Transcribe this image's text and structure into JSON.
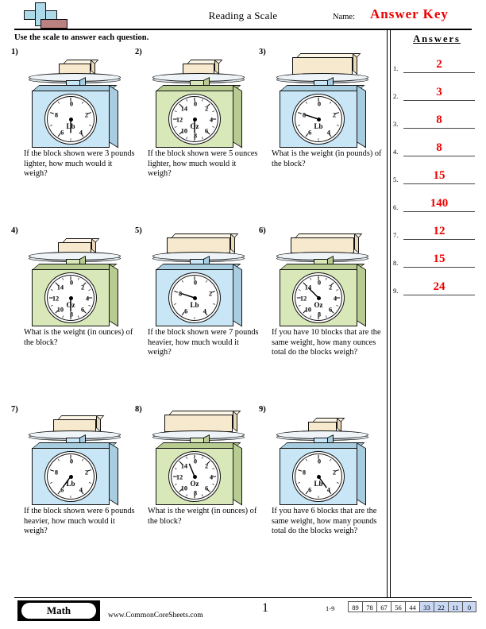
{
  "header": {
    "title": "Reading a Scale",
    "name_label": "Name:",
    "name_value": "Answer Key",
    "logo_icon": "plus-block-logo",
    "accent_color": "#ee0000"
  },
  "instructions": "Use the scale to answer each question.",
  "answers_panel": {
    "title": "Answers",
    "rows": [
      {
        "num": "1.",
        "value": "2"
      },
      {
        "num": "2.",
        "value": "3"
      },
      {
        "num": "3.",
        "value": "8"
      },
      {
        "num": "4.",
        "value": "8"
      },
      {
        "num": "5.",
        "value": "15"
      },
      {
        "num": "6.",
        "value": "140"
      },
      {
        "num": "7.",
        "value": "12"
      },
      {
        "num": "8.",
        "value": "15"
      },
      {
        "num": "9.",
        "value": "24"
      }
    ]
  },
  "problems": [
    {
      "num": "1)",
      "text": "If the block shown were 3 pounds lighter, how much would it weigh?",
      "scale": {
        "color": "#c8e6f5",
        "color_dark": "#a8cde0",
        "unit": "Lb",
        "ticks": [
          "0",
          "2",
          "4",
          "6",
          "8"
        ],
        "max": 10,
        "reading": 5,
        "block_width": 40,
        "block_height": 14
      }
    },
    {
      "num": "2)",
      "text": "If the block shown were 5 ounces lighter, how much would it weigh?",
      "scale": {
        "color": "#d8e8b8",
        "color_dark": "#b8cc92",
        "unit": "Oz",
        "ticks": [
          "0",
          "2",
          "4",
          "6",
          "8",
          "10",
          "12",
          "14"
        ],
        "max": 16,
        "reading": 8,
        "block_width": 40,
        "block_height": 14
      }
    },
    {
      "num": "3)",
      "text": "What is the weight (in pounds) of the block?",
      "scale": {
        "color": "#c8e6f5",
        "color_dark": "#a8cde0",
        "unit": "Lb",
        "ticks": [
          "0",
          "2",
          "4",
          "6",
          "8"
        ],
        "max": 10,
        "reading": 8,
        "block_width": 76,
        "block_height": 22
      }
    },
    {
      "num": "4)",
      "text": "What is the weight (in ounces) of the block?",
      "scale": {
        "color": "#d8e8b8",
        "color_dark": "#b8cc92",
        "unit": "Oz",
        "ticks": [
          "0",
          "2",
          "4",
          "6",
          "8",
          "10",
          "12",
          "14"
        ],
        "max": 16,
        "reading": 8,
        "block_width": 42,
        "block_height": 14
      }
    },
    {
      "num": "5)",
      "text": "If the block shown were 7 pounds heavier, how much would it weigh?",
      "scale": {
        "color": "#c8e6f5",
        "color_dark": "#a8cde0",
        "unit": "Lb",
        "ticks": [
          "0",
          "2",
          "4",
          "6",
          "8"
        ],
        "max": 10,
        "reading": 8,
        "block_width": 80,
        "block_height": 20
      }
    },
    {
      "num": "6)",
      "text": "If you have 10 blocks that are the same weight, how many ounces total do the blocks weigh?",
      "scale": {
        "color": "#d8e8b8",
        "color_dark": "#b8cc92",
        "unit": "Oz",
        "ticks": [
          "0",
          "2",
          "4",
          "6",
          "8",
          "10",
          "12",
          "14"
        ],
        "max": 16,
        "reading": 14,
        "block_width": 80,
        "block_height": 20
      }
    },
    {
      "num": "7)",
      "text": "If the block shown were 6 pounds heavier, how much would it weigh?",
      "scale": {
        "color": "#c8e6f5",
        "color_dark": "#a8cde0",
        "unit": "Lb",
        "ticks": [
          "0",
          "2",
          "4",
          "6",
          "8"
        ],
        "max": 10,
        "reading": 6,
        "block_width": 54,
        "block_height": 16
      }
    },
    {
      "num": "8)",
      "text": "What is the weight (in ounces) of the block?",
      "scale": {
        "color": "#d8e8b8",
        "color_dark": "#b8cc92",
        "unit": "Oz",
        "ticks": [
          "0",
          "2",
          "4",
          "6",
          "8",
          "10",
          "12",
          "14"
        ],
        "max": 16,
        "reading": 15,
        "block_width": 86,
        "block_height": 22
      }
    },
    {
      "num": "9)",
      "text": "If you have 6 blocks that are the same weight, how many pounds total do the blocks weigh?",
      "scale": {
        "color": "#c8e6f5",
        "color_dark": "#a8cde0",
        "unit": "Lb",
        "ticks": [
          "0",
          "2",
          "4",
          "6",
          "8"
        ],
        "max": 10,
        "reading": 4,
        "block_width": 36,
        "block_height": 13
      }
    }
  ],
  "footer": {
    "subject": "Math",
    "site": "www.CommonCoreSheets.com",
    "page_number": "1",
    "range_label": "1-9",
    "grade_cells": [
      {
        "value": "89",
        "highlight": false
      },
      {
        "value": "78",
        "highlight": false
      },
      {
        "value": "67",
        "highlight": false
      },
      {
        "value": "56",
        "highlight": false
      },
      {
        "value": "44",
        "highlight": false
      },
      {
        "value": "33",
        "highlight": true
      },
      {
        "value": "22",
        "highlight": true
      },
      {
        "value": "11",
        "highlight": true
      },
      {
        "value": "0",
        "highlight": true
      }
    ]
  }
}
